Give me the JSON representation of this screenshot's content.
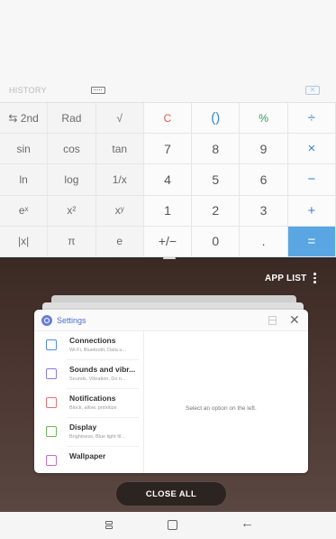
{
  "calculator": {
    "history_label": "HISTORY",
    "icons": {
      "keyboard": "keyboard-icon",
      "backspace": "backspace-icon"
    },
    "keys": [
      {
        "label": "⇆ 2nd",
        "kind": "sci"
      },
      {
        "label": "Rad",
        "kind": "sci"
      },
      {
        "label": "√",
        "kind": "sci"
      },
      {
        "label": "C",
        "kind": "red"
      },
      {
        "label": "()",
        "kind": "blue"
      },
      {
        "label": "%",
        "kind": "green"
      },
      {
        "label": "÷",
        "kind": "blue"
      },
      {
        "label": "sin",
        "kind": "sci"
      },
      {
        "label": "cos",
        "kind": "sci"
      },
      {
        "label": "tan",
        "kind": "sci"
      },
      {
        "label": "7",
        "kind": "num"
      },
      {
        "label": "8",
        "kind": "num"
      },
      {
        "label": "9",
        "kind": "num"
      },
      {
        "label": "×",
        "kind": "blue"
      },
      {
        "label": "ln",
        "kind": "sci"
      },
      {
        "label": "log",
        "kind": "sci"
      },
      {
        "label": "1/x",
        "kind": "sci"
      },
      {
        "label": "4",
        "kind": "num"
      },
      {
        "label": "5",
        "kind": "num"
      },
      {
        "label": "6",
        "kind": "num"
      },
      {
        "label": "−",
        "kind": "blue"
      },
      {
        "label": "eˣ",
        "kind": "sci"
      },
      {
        "label": "x²",
        "kind": "sci"
      },
      {
        "label": "xʸ",
        "kind": "sci"
      },
      {
        "label": "1",
        "kind": "num"
      },
      {
        "label": "2",
        "kind": "num"
      },
      {
        "label": "3",
        "kind": "num"
      },
      {
        "label": "+",
        "kind": "blue"
      },
      {
        "label": "|x|",
        "kind": "sci"
      },
      {
        "label": "π",
        "kind": "sci"
      },
      {
        "label": "e",
        "kind": "sci"
      },
      {
        "label": "+/−",
        "kind": "num"
      },
      {
        "label": "0",
        "kind": "num"
      },
      {
        "label": ".",
        "kind": "num"
      },
      {
        "label": "=",
        "kind": "eq"
      }
    ]
  },
  "recents": {
    "app_list_label": "APP LIST",
    "close_all_label": "CLOSE ALL",
    "card": {
      "title": "Settings",
      "items": [
        {
          "title": "Connections",
          "subtitle": "Wi-Fi, Bluetooth, Data u...",
          "icon": "connections-icon",
          "color": "#4f8fd9"
        },
        {
          "title": "Sounds and vibr...",
          "subtitle": "Sounds, Vibration, Do n...",
          "icon": "sound-icon",
          "color": "#8a7ae0"
        },
        {
          "title": "Notifications",
          "subtitle": "Block, allow, prioritize",
          "icon": "notifications-icon",
          "color": "#e07070"
        },
        {
          "title": "Display",
          "subtitle": "Brightness, Blue light fil...",
          "icon": "display-icon",
          "color": "#6cb35a"
        },
        {
          "title": "Wallpaper",
          "subtitle": "",
          "icon": "wallpaper-icon",
          "color": "#c96fc4"
        }
      ],
      "detail_placeholder": "Select an option on the left."
    }
  },
  "navbar": {
    "icons": [
      "recents-icon",
      "home-icon",
      "back-icon"
    ]
  }
}
